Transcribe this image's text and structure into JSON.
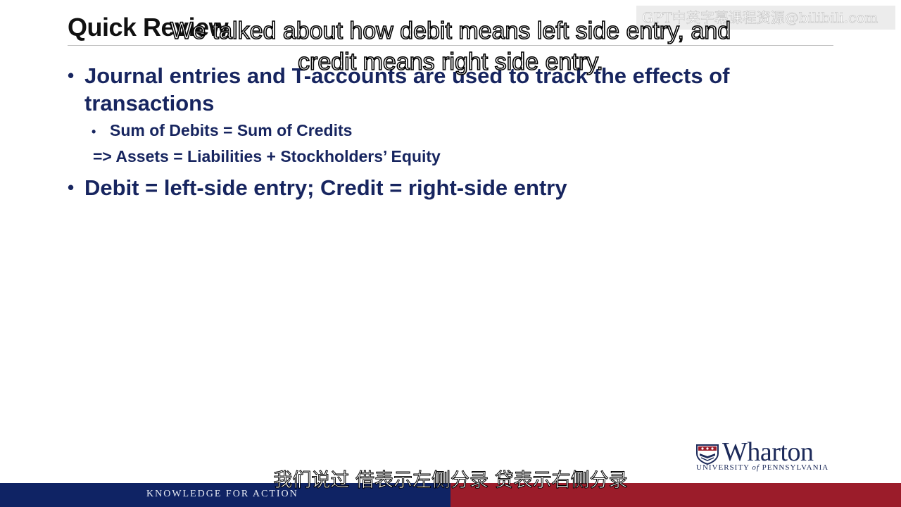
{
  "slide": {
    "title": "Quick Review",
    "bullets": [
      {
        "text": "Journal entries and T-accounts are used to track the effects of transactions",
        "sub_bullet": "Sum of Debits = Sum of Credits",
        "sub_line": "=> Assets = Liabilities + Stockholders’ Equity"
      },
      {
        "text": "Debit = left-side entry; Credit = right-side entry"
      }
    ],
    "bullet_glyph": "•"
  },
  "subtitles": {
    "english": "We talked about how debit means left side entry, and credit means right side entry.",
    "chinese": "我们说过 借表示左侧分录 贷表示右侧分录"
  },
  "watermark": "GPT中英字幕课程资源@bilibili.com",
  "logo": {
    "name": "Wharton",
    "line_before": "UNIVERSITY",
    "line_of": "of",
    "line_after": "PENNSYLVANIA"
  },
  "footer": {
    "tagline": "KNOWLEDGE FOR ACTION"
  },
  "colors": {
    "navy": "#0f2364",
    "crimson": "#9b1c2a",
    "bullet_text": "#17255f"
  }
}
